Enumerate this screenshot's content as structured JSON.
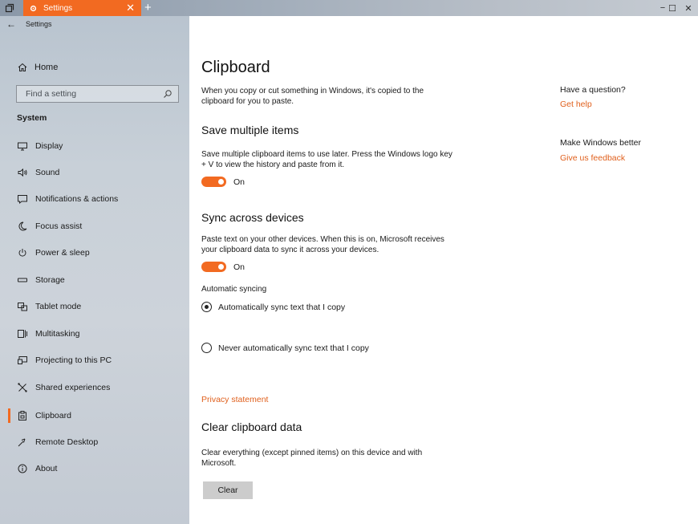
{
  "window": {
    "tab_title": "Settings",
    "tab_close_glyph": "✕",
    "new_tab_glyph": "+",
    "minimize_glyph": "−",
    "maximize_glyph": "☐",
    "close_glyph": "✕",
    "accent_color": "#f26a21"
  },
  "sidebar": {
    "back_glyph": "←",
    "app_name": "Settings",
    "home_label": "Home",
    "search_placeholder": "Find a setting",
    "section_label": "System",
    "items": [
      {
        "label": "Display",
        "icon": "display-icon"
      },
      {
        "label": "Sound",
        "icon": "sound-icon"
      },
      {
        "label": "Notifications & actions",
        "icon": "notifications-icon"
      },
      {
        "label": "Focus assist",
        "icon": "moon-icon"
      },
      {
        "label": "Power & sleep",
        "icon": "power-icon"
      },
      {
        "label": "Storage",
        "icon": "storage-icon"
      },
      {
        "label": "Tablet mode",
        "icon": "tablet-icon"
      },
      {
        "label": "Multitasking",
        "icon": "multitasking-icon"
      },
      {
        "label": "Projecting to this PC",
        "icon": "projecting-icon"
      },
      {
        "label": "Shared experiences",
        "icon": "shared-icon"
      },
      {
        "label": "Clipboard",
        "icon": "clipboard-icon"
      },
      {
        "label": "Remote Desktop",
        "icon": "remote-desktop-icon"
      },
      {
        "label": "About",
        "icon": "info-icon"
      }
    ],
    "active_item": "Clipboard"
  },
  "main": {
    "title": "Clipboard",
    "intro": "When you copy or cut something in Windows, it's copied to the clipboard for you to paste.",
    "save_multiple": {
      "heading": "Save multiple items",
      "description": "Save multiple clipboard items to use later. Press the Windows logo key + V to view the history and paste from it.",
      "toggle_label": "On"
    },
    "sync": {
      "heading": "Sync across devices",
      "description": "Paste text on your other devices. When this is on, Microsoft receives your clipboard data to sync it across your devices.",
      "toggle_label": "On",
      "auto_label": "Automatic syncing",
      "option_auto": "Automatically sync text that I copy",
      "option_never": "Never automatically sync text that I copy"
    },
    "privacy_link": "Privacy statement",
    "clear": {
      "heading": "Clear clipboard data",
      "description": "Clear everything (except pinned items) on this device and with Microsoft.",
      "button": "Clear"
    }
  },
  "aside": {
    "question_heading": "Have a question?",
    "get_help": "Get help",
    "better_heading": "Make Windows better",
    "feedback": "Give us feedback"
  }
}
